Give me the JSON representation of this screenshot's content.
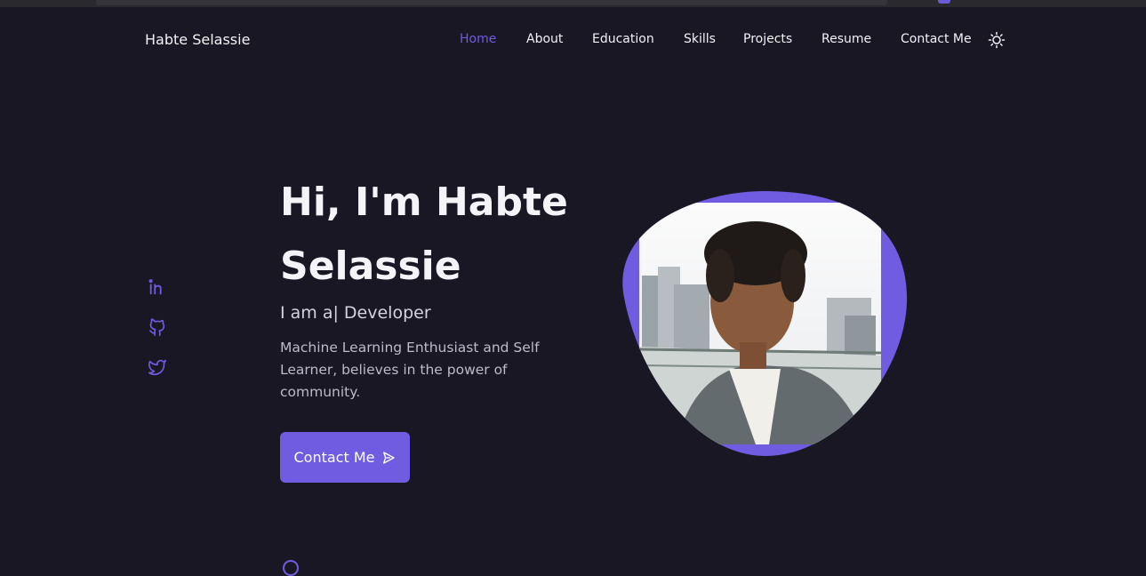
{
  "brand": "Habte Selassie",
  "nav": [
    "Home",
    "About",
    "Education",
    "Skills",
    "Projects",
    "Resume",
    "Contact Me"
  ],
  "icons": {
    "theme": "sun-icon",
    "social": [
      "linkedin-icon",
      "github-icon",
      "twitter-icon"
    ],
    "button": "send-icon"
  },
  "hero": {
    "title_line1": "Hi, I'm Habte",
    "title_line2": "Selassie",
    "subtitle": "I am a| Developer",
    "description": "Machine Learning Enthusiast and Self Learner, believes in the power of community.",
    "button": "Contact Me"
  },
  "colors": {
    "background": "#1a1725",
    "accent": "#6f5ce0",
    "text": "#f4f4f8"
  }
}
